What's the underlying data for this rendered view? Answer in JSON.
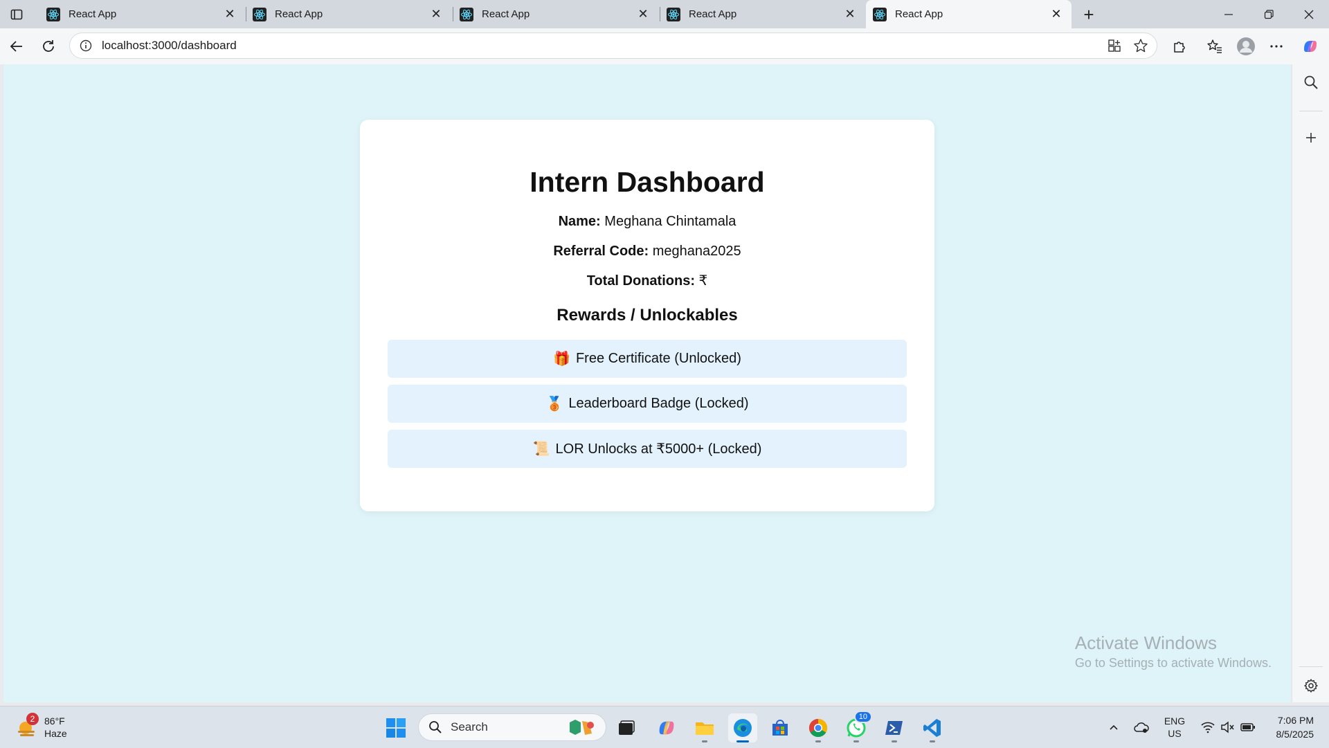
{
  "browser": {
    "tabs": [
      {
        "title": "React App",
        "active": false
      },
      {
        "title": "React App",
        "active": false
      },
      {
        "title": "React App",
        "active": false
      },
      {
        "title": "React App",
        "active": false
      },
      {
        "title": "React App",
        "active": true
      }
    ],
    "url": "localhost:3000/dashboard"
  },
  "dashboard": {
    "title": "Intern Dashboard",
    "name_label": "Name:",
    "name_value": "Meghana Chintamala",
    "referral_label": "Referral Code:",
    "referral_value": "meghana2025",
    "donations_label": "Total Donations:",
    "donations_value": "₹",
    "rewards_heading": "Rewards / Unlockables",
    "rewards": [
      {
        "emoji": "🎁",
        "text": "Free Certificate (Unlocked)"
      },
      {
        "emoji": "🥉",
        "text": "Leaderboard Badge (Locked)"
      },
      {
        "emoji": "📜",
        "text": "LOR Unlocks at ₹5000+ (Locked)"
      }
    ]
  },
  "watermark": {
    "line1": "Activate Windows",
    "line2": "Go to Settings to activate Windows."
  },
  "taskbar": {
    "weather_temp": "86°F",
    "weather_desc": "Haze",
    "weather_badge": "2",
    "search_placeholder": "Search",
    "whatsapp_badge": "10",
    "lang_line1": "ENG",
    "lang_line2": "US",
    "time": "7:06 PM",
    "date": "8/5/2025"
  },
  "colors": {
    "page_background": "#dff4f8",
    "reward_background": "#e3f2fc",
    "card_background": "#ffffff",
    "accent": "#0067c0"
  }
}
